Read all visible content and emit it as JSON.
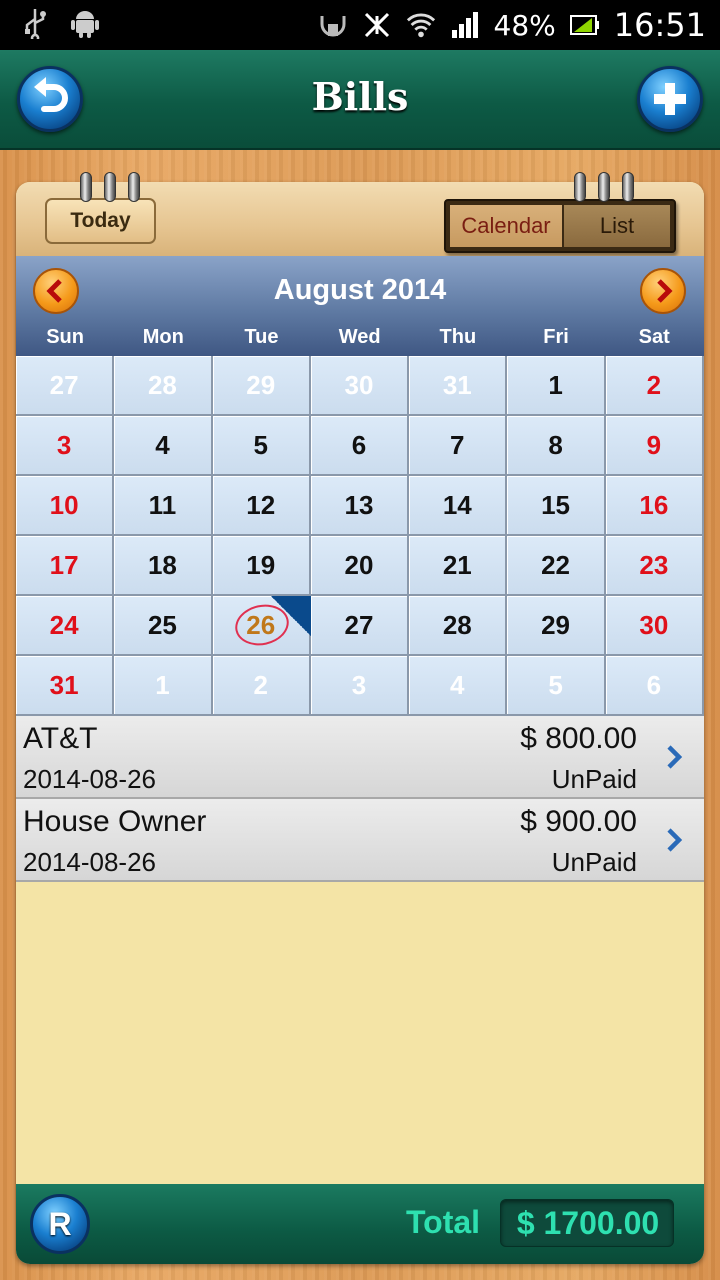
{
  "status_bar": {
    "battery": "48%",
    "time": "16:51",
    "icons": [
      "usb-icon",
      "android-icon",
      "nfc-icon",
      "vibrate-off-icon",
      "wifi-icon",
      "signal-icon",
      "battery-icon"
    ]
  },
  "header": {
    "title": "Bills"
  },
  "toolbar": {
    "today_label": "Today",
    "calendar_label": "Calendar",
    "list_label": "List"
  },
  "calendar": {
    "month_title": "August 2014",
    "weekdays": [
      "Sun",
      "Mon",
      "Tue",
      "Wed",
      "Thu",
      "Fri",
      "Sat"
    ],
    "weeks": [
      [
        "27",
        "28",
        "29",
        "30",
        "31",
        "1",
        "2"
      ],
      [
        "3",
        "4",
        "5",
        "6",
        "7",
        "8",
        "9"
      ],
      [
        "10",
        "11",
        "12",
        "13",
        "14",
        "15",
        "16"
      ],
      [
        "17",
        "18",
        "19",
        "20",
        "21",
        "22",
        "23"
      ],
      [
        "24",
        "25",
        "26",
        "27",
        "28",
        "29",
        "30"
      ],
      [
        "31",
        "1",
        "2",
        "3",
        "4",
        "5",
        "6"
      ]
    ],
    "today": "26"
  },
  "bills": [
    {
      "name": "AT&T",
      "date": "2014-08-26",
      "amount": "$ 800.00",
      "status": "UnPaid"
    },
    {
      "name": "House Owner",
      "date": "2014-08-26",
      "amount": "$ 900.00",
      "status": "UnPaid"
    }
  ],
  "footer": {
    "r_label": "R",
    "total_label": "Total",
    "total_value": "$ 1700.00"
  },
  "colors": {
    "header": "#0d5a45",
    "weekend": "#e0101a",
    "total": "#2ee0b0",
    "calendar_header": "#5f7aa3"
  }
}
